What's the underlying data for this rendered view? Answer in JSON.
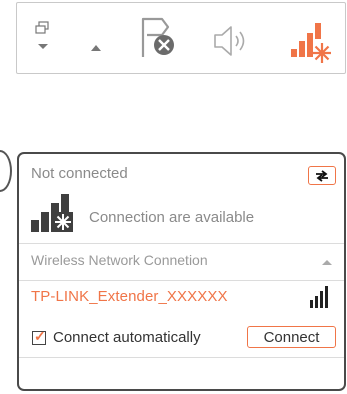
{
  "taskbar": {
    "icons": [
      "show-desktop-icon",
      "chevron-up-icon",
      "action-center-flag-icon",
      "volume-icon",
      "wifi-signal-icon"
    ],
    "accent": "#f07548"
  },
  "network_panel": {
    "status_label": "Not connected",
    "availability_label": "Connection are available",
    "section_label": "Wireless Network Connetion",
    "network": {
      "ssid": "TP-LINK_Extender_XXXXXX",
      "signal_bars": 4
    },
    "auto_connect": {
      "label": "Connect automatically",
      "checked": true
    },
    "connect_button": "Connect"
  }
}
